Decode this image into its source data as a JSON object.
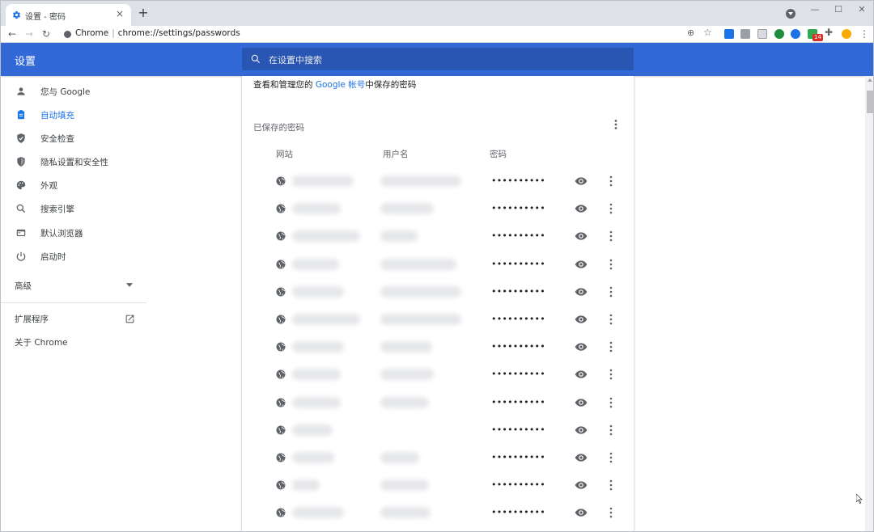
{
  "browser": {
    "tab_title": "设置 - 密码",
    "tab_close": "×",
    "new_tab": "+",
    "url_host": "Chrome",
    "url_separator": "|",
    "url_path": "chrome://settings/passwords",
    "ext_badge": "14",
    "window_controls": [
      "—",
      "☐",
      "✕"
    ]
  },
  "header": {
    "title": "设置",
    "search_placeholder": "在设置中搜索"
  },
  "sidebar": {
    "items": [
      {
        "label": "您与 Google",
        "icon": "person-icon"
      },
      {
        "label": "自动填充",
        "icon": "clipboard-icon",
        "active": true
      },
      {
        "label": "安全检查",
        "icon": "shield-check-icon"
      },
      {
        "label": "隐私设置和安全性",
        "icon": "shield-icon"
      },
      {
        "label": "外观",
        "icon": "palette-icon"
      },
      {
        "label": "搜索引擎",
        "icon": "search-icon"
      },
      {
        "label": "默认浏览器",
        "icon": "browser-icon"
      },
      {
        "label": "启动时",
        "icon": "power-icon"
      }
    ],
    "advanced": "高级",
    "extensions": "扩展程序",
    "about": "关于 Chrome"
  },
  "content": {
    "intro_prefix": "查看和管理您的 ",
    "intro_link": "Google 帐号",
    "intro_suffix": "中保存的密码",
    "section_title": "已保存的密码",
    "columns": {
      "site": "网站",
      "username": "用户名",
      "password": "密码"
    },
    "password_mask": "••••••••••",
    "rows": [
      {
        "site": "",
        "username": ""
      },
      {
        "site": "",
        "username": ""
      },
      {
        "site": "",
        "username": ""
      },
      {
        "site": "",
        "username": ""
      },
      {
        "site": "",
        "username": ""
      },
      {
        "site": "",
        "username": ""
      },
      {
        "site": "",
        "username": ""
      },
      {
        "site": "",
        "username": ""
      },
      {
        "site": "",
        "username": ""
      },
      {
        "site": "",
        "username": ""
      },
      {
        "site": "",
        "username": ""
      },
      {
        "site": "",
        "username": ""
      },
      {
        "site": "",
        "username": ""
      }
    ]
  },
  "colors": {
    "header_blue": "#3369d6",
    "link_blue": "#1a73e8",
    "icon_gray": "#5f6368"
  }
}
